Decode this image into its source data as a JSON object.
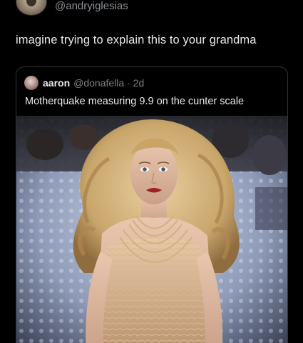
{
  "author": {
    "handle": "@andryiglesias"
  },
  "tweet": {
    "text": "imagine trying to explain this to your grandma"
  },
  "quote": {
    "name": "aaron",
    "handle_time": "@donafella · 2d",
    "text": "Motherquake measuring 9.9 on the cunter scale"
  },
  "colors": {
    "background": "#000000",
    "text": "#e8eaed",
    "muted": "#8b8f94",
    "card_border": "#2f3336"
  }
}
